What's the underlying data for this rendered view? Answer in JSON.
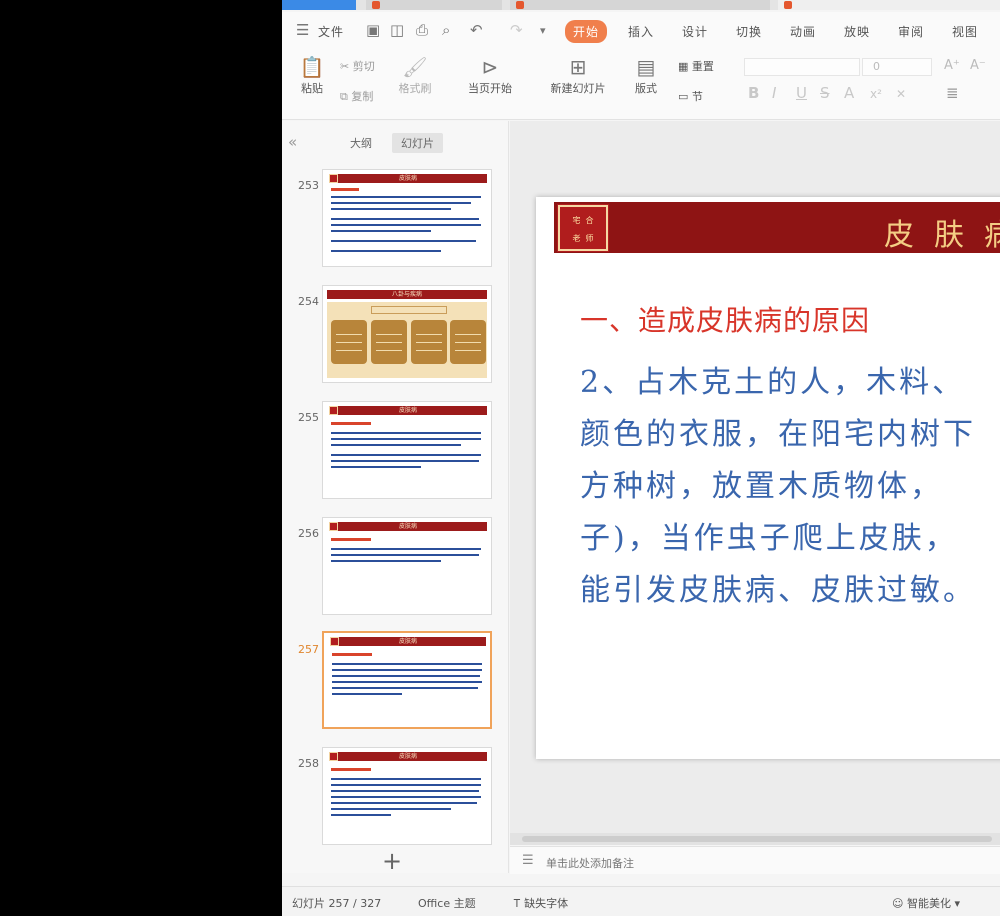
{
  "menu": {
    "file": "文件",
    "start": "开始",
    "insert": "插入",
    "design": "设计",
    "transition": "切换",
    "animation": "动画",
    "slideshow": "放映",
    "review": "审阅",
    "view": "视图"
  },
  "ribbon": {
    "paste": "粘贴",
    "cut": "剪切",
    "copy": "复制",
    "format_painter": "格式刷",
    "play_from_current": "当页开始",
    "new_slide": "新建幻灯片",
    "layout": "版式",
    "section": "节",
    "reset": "重置",
    "font_size": "0"
  },
  "left_panel": {
    "tab_outline": "大纲",
    "tab_slides": "幻灯片",
    "thumbnails": [
      {
        "number": "253",
        "title": "皮肤病"
      },
      {
        "number": "254",
        "title": "八卦与疾病"
      },
      {
        "number": "255",
        "title": "皮肤病"
      },
      {
        "number": "256",
        "title": "皮肤病"
      },
      {
        "number": "257",
        "title": "皮肤病"
      },
      {
        "number": "258",
        "title": "皮肤病"
      }
    ],
    "add_slide": "+"
  },
  "slide": {
    "logo_top": "宅合",
    "logo_bottom": "老师",
    "title": "皮肤病",
    "heading": "一、造成皮肤病的原因",
    "lines": [
      "2、占木克土的人，木料、",
      "颜色的衣服，在阳宅内树下",
      "方种树，放置木质物体，",
      "子)，当作虫子爬上皮肤，",
      "能引发皮肤病、皮肤过敏。"
    ]
  },
  "notes": {
    "placeholder": "单击此处添加备注"
  },
  "status": {
    "slide_counter": "幻灯片 257 / 327",
    "theme": "Office 主题",
    "missing_font": "缺失字体",
    "smart_beautify": "智能美化"
  }
}
